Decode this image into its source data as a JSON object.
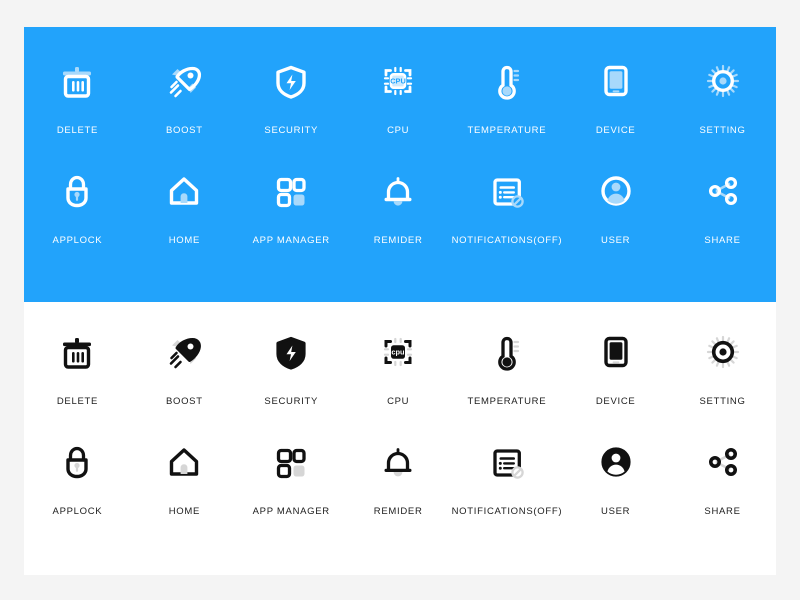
{
  "page": {
    "background_color": "#f4f4f4",
    "card_background": "#ffffff"
  },
  "panels": [
    {
      "id": "blue-theme",
      "background_color": "#22a3fb",
      "icon_color": "#ffffff",
      "accent_color": "#a8d9fb",
      "label_color": "#ffffff"
    },
    {
      "id": "dark-theme",
      "background_color": "#ffffff",
      "icon_color": "#111111",
      "accent_color": "#d6d6d6",
      "label_color": "#1d1d1d"
    }
  ],
  "icons": [
    {
      "key": "delete",
      "label": "DELETE",
      "icon": "trash-icon"
    },
    {
      "key": "boost",
      "label": "BOOST",
      "icon": "rocket-icon"
    },
    {
      "key": "security",
      "label": "SECURITY",
      "icon": "shield-bolt-icon"
    },
    {
      "key": "cpu",
      "label": "CPU",
      "icon": "cpu-icon",
      "glyph_text_blue": "CPU",
      "glyph_text_dark": "cpu"
    },
    {
      "key": "temperature",
      "label": "TEMPERATURE",
      "icon": "thermometer-icon"
    },
    {
      "key": "device",
      "label": "DEVICE",
      "icon": "phone-icon"
    },
    {
      "key": "setting",
      "label": "SETTING",
      "icon": "gear-sun-icon"
    },
    {
      "key": "applock",
      "label": "APPLOCK",
      "icon": "padlock-open-icon"
    },
    {
      "key": "home",
      "label": "HOME",
      "icon": "house-icon"
    },
    {
      "key": "app_manager",
      "label": "APP MANAGER",
      "icon": "grid-squares-icon"
    },
    {
      "key": "remider",
      "label": "REMIDER",
      "icon": "bell-icon"
    },
    {
      "key": "notifications",
      "label": "NOTIFICATIONS(OFF)",
      "icon": "notification-off-icon"
    },
    {
      "key": "user",
      "label": "USER",
      "icon": "user-avatar-icon"
    },
    {
      "key": "share",
      "label": "SHARE",
      "icon": "share-nodes-icon"
    }
  ]
}
